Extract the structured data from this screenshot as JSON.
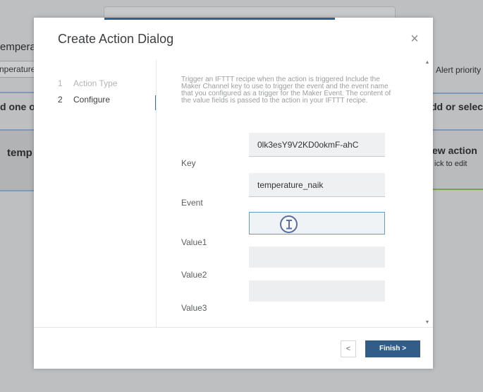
{
  "background": {
    "left_heading": "emperat",
    "left_input": "nperature",
    "left_subheading": "d one or",
    "left_card_title": "temp",
    "right_label": "Alert priority",
    "right_subheading": "dd or selec",
    "right_card_title": "ew action",
    "right_card_hint": "ick to edit"
  },
  "dialog": {
    "title": "Create Action Dialog",
    "close_glyph": "×",
    "steps": [
      {
        "num": "1",
        "label": "Action Type"
      },
      {
        "num": "2",
        "label": "Configure"
      }
    ],
    "description": "Trigger an IFTTT recipe when the action is triggered Include the Maker Channel key to use to trigger the event and the event name that you configured as a trigger for the Maker Event. The content of the value fields is passed to the action in your IFTTT recipe.",
    "fields": {
      "key": {
        "label": "Key",
        "value": "0lk3esY9V2KD0okmF-ahC"
      },
      "event": {
        "label": "Event",
        "value": "temperature_naik"
      },
      "value1": {
        "label": "Value1",
        "value": ""
      },
      "value2": {
        "label": "Value2",
        "value": ""
      },
      "value3": {
        "label": "Value3",
        "value": ""
      }
    },
    "scroll_up": "▲",
    "scroll_down": "▼",
    "back_label": "<",
    "finish_label": "Finish >"
  }
}
